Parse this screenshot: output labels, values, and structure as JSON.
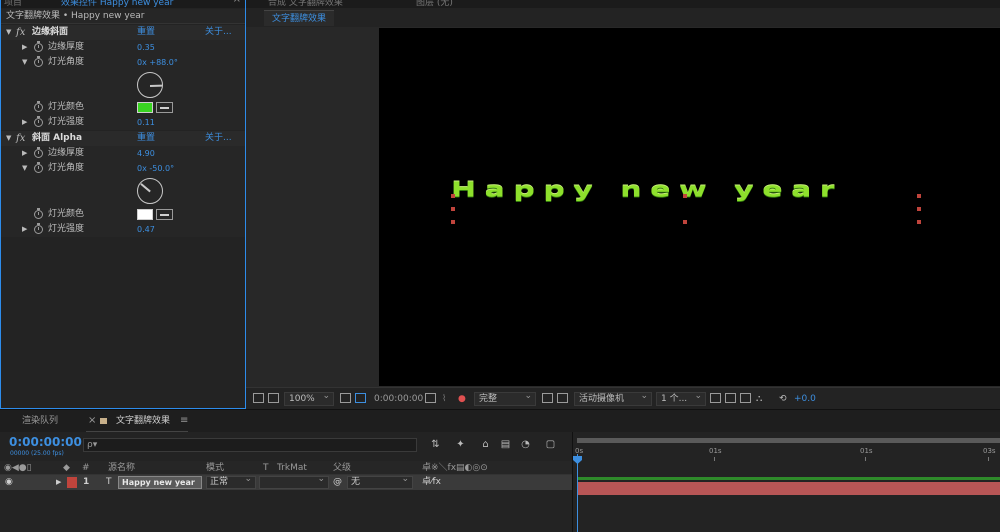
{
  "effect_controls": {
    "tab_ghost_left": "项目",
    "tab_ghost_title": "效果控件 Happy new year",
    "subheader": "文字翻牌效果 • Happy new year",
    "effects": [
      {
        "name": "边缘斜面",
        "reset_label": "重置",
        "about_label": "关于...",
        "props": {
          "edge_thickness": {
            "label": "边缘厚度",
            "value": "0.35"
          },
          "light_angle": {
            "label": "灯光角度",
            "value": "0x +88.0°",
            "angle_deg": 88
          },
          "light_color": {
            "label": "灯光颜色",
            "color": "#39d421"
          },
          "light_intensity": {
            "label": "灯光强度",
            "value": "0.11"
          }
        }
      },
      {
        "name": "斜面 Alpha",
        "reset_label": "重置",
        "about_label": "关于...",
        "props": {
          "edge_thickness": {
            "label": "边缘厚度",
            "value": "4.90"
          },
          "light_angle": {
            "label": "灯光角度",
            "value": "0x -50.0°",
            "angle_deg": -50
          },
          "light_color": {
            "label": "灯光颜色",
            "color": "#ffffff"
          },
          "light_intensity": {
            "label": "灯光强度",
            "value": "0.47"
          }
        }
      }
    ]
  },
  "composition": {
    "tab_ghost": "合成 文字翻牌效果",
    "tab_ghost_right": "图层 (无)",
    "tab_label": "文字翻牌效果",
    "text_layer": "Happy new year",
    "text_color": "#8ee02c",
    "toolbar": {
      "zoom": "100%",
      "timecode": "0:00:00:00",
      "resolution": "完整",
      "camera": "活动摄像机",
      "views": "1 个...",
      "exposure": "+0.0"
    }
  },
  "timeline": {
    "tab_render_queue": "渲染队列",
    "tab_comp": "文字翻牌效果",
    "close_glyph": "×",
    "menu_glyph": "≡",
    "timecode": "0:00:00:00",
    "fps": "00000 (25.00 fps)",
    "search_placeholder": "ρ▾",
    "columns": {
      "num": "#",
      "source_name": "源名称",
      "mode": "模式",
      "t": "T",
      "trkmat": "TrkMat",
      "parent": "父级"
    },
    "layer": {
      "number": "1",
      "type_glyph": "T",
      "name": "Happy new year",
      "mode": "正常",
      "parent": "无",
      "label_color": "#c0443c"
    },
    "ruler_labels": [
      "0s",
      "01s",
      "01s",
      "03s"
    ]
  }
}
